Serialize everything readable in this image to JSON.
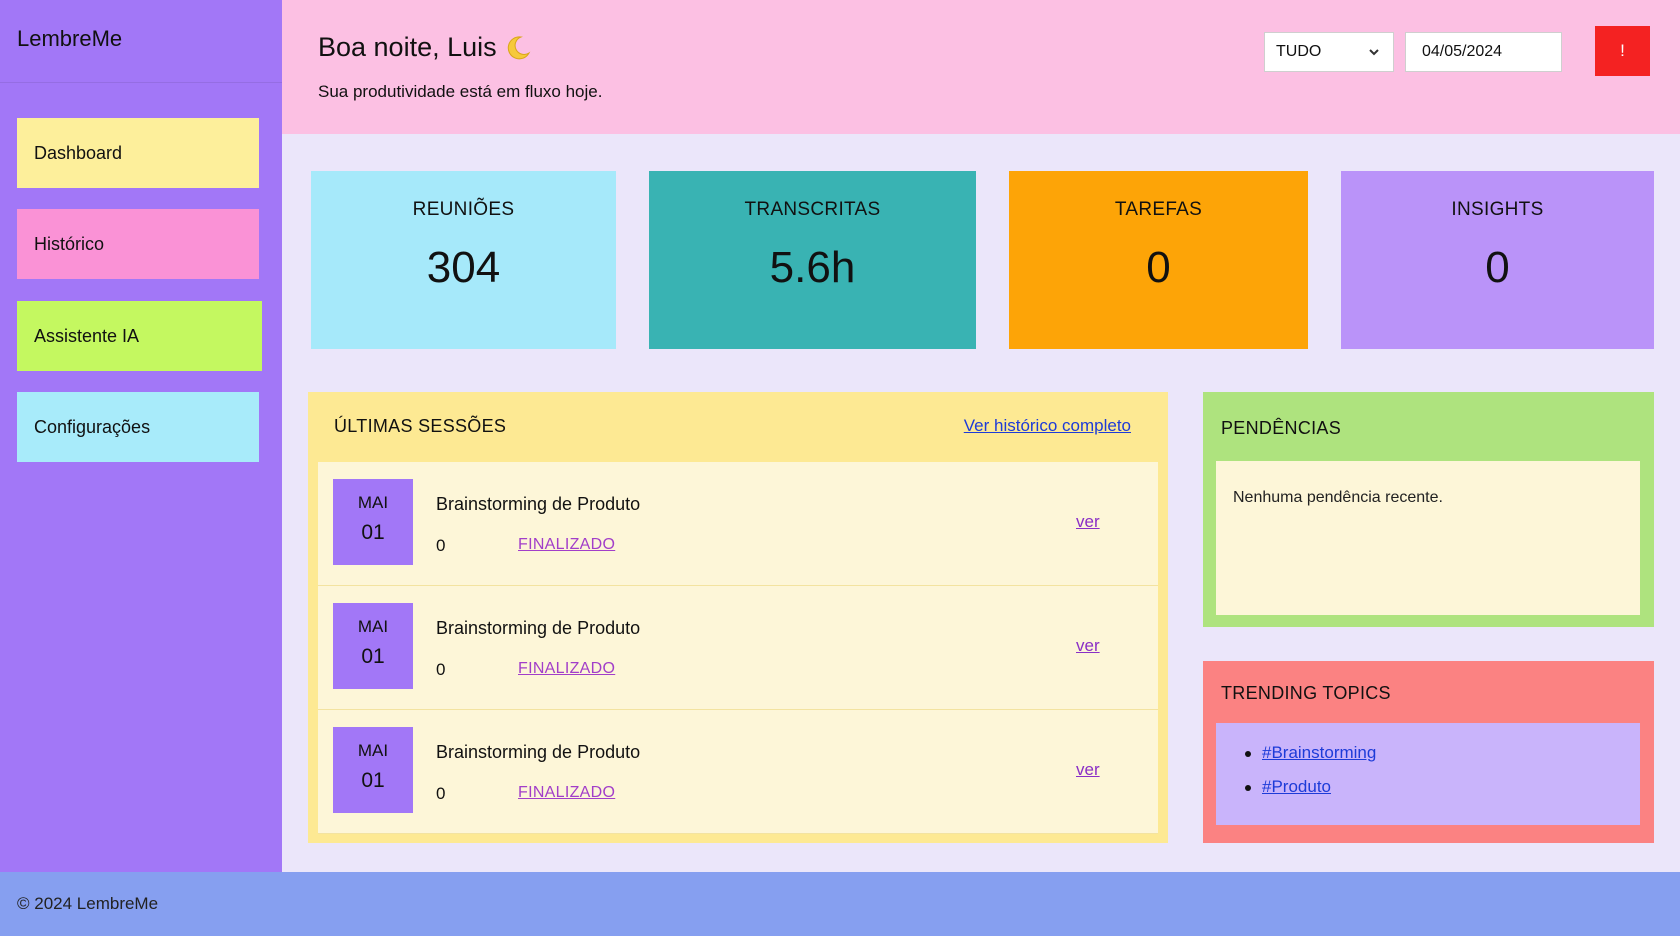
{
  "sidebar": {
    "brand": "LembreMe",
    "items": [
      {
        "label": "Dashboard",
        "color": "#fdef9b"
      },
      {
        "label": "Histórico",
        "color": "#fa92d6"
      },
      {
        "label": "Assistente IA",
        "color": "#c4f860"
      },
      {
        "label": "Configurações",
        "color": "#a8ebfa"
      }
    ],
    "color": "#a277f7"
  },
  "header": {
    "greeting": "Boa noite, Luis",
    "greeting_icon": "moon-icon",
    "subtitle": "Sua produtividade está em fluxo hoje.",
    "filter": {
      "selected": "TUDO"
    },
    "date": "04/05/2024",
    "alert_label": "!",
    "alert_color": "#f42222",
    "color": "#fcc0e3"
  },
  "stats": [
    {
      "label": "REUNIÕES",
      "value": "304",
      "color": "#a6e9fa"
    },
    {
      "label": "TRANSCRITAS",
      "value": "5.6h",
      "color": "#39b3b3"
    },
    {
      "label": "TAREFAS",
      "value": "0",
      "color": "#fda407"
    },
    {
      "label": "INSIGHTS",
      "value": "0",
      "color": "#ba93f9"
    }
  ],
  "sessions": {
    "title": "ÚLTIMAS SESSÕES",
    "link": "Ver histórico completo",
    "items": [
      {
        "month": "MAI",
        "day": "01",
        "name": "Brainstorming de Produto",
        "count": "0",
        "status": "FINALIZADO",
        "view": "ver"
      },
      {
        "month": "MAI",
        "day": "01",
        "name": "Brainstorming de Produto",
        "count": "0",
        "status": "FINALIZADO",
        "view": "ver"
      },
      {
        "month": "MAI",
        "day": "01",
        "name": "Brainstorming de Produto",
        "count": "0",
        "status": "FINALIZADO",
        "view": "ver"
      }
    ]
  },
  "pending": {
    "title": "PENDÊNCIAS",
    "empty_text": "Nenhuma pendência recente."
  },
  "trending": {
    "title": "TRENDING TOPICS",
    "topics": [
      "#Brainstorming",
      "#Produto"
    ]
  },
  "footer": {
    "text": "© 2024 LembreMe"
  }
}
